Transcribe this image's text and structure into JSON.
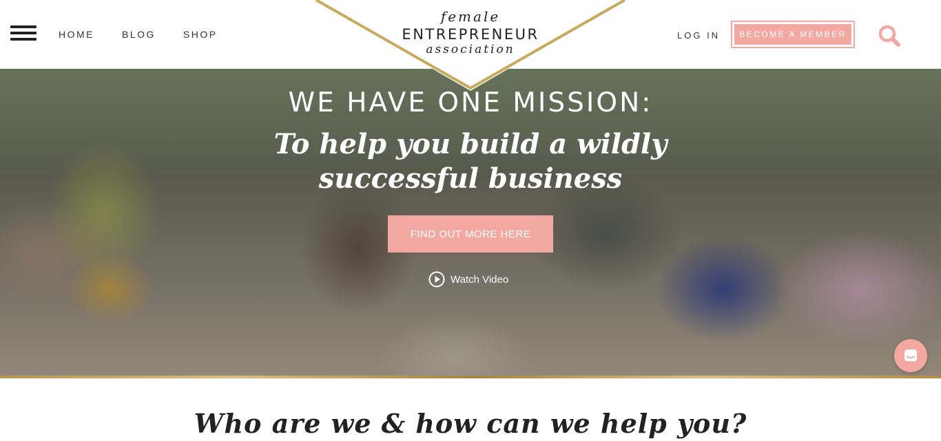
{
  "header": {
    "nav": [
      {
        "label": "HOME"
      },
      {
        "label": "BLOG"
      },
      {
        "label": "SHOP"
      }
    ],
    "logo": {
      "line1": "female",
      "line2": "ENTREPRENEUR",
      "line3": "association"
    },
    "login_label": "LOG IN",
    "member_label": "BECOME A MEMBER"
  },
  "hero": {
    "headline": "WE HAVE ONE MISSION:",
    "tagline": "To help you build a wildly successful business",
    "cta_label": "FIND OUT MORE HERE",
    "watch_label": "Watch Video"
  },
  "section": {
    "title": "Who are we & how can we help you?"
  },
  "colors": {
    "accent": "#f4a8a2",
    "gold": "#c9a95e",
    "text": "#222222"
  },
  "icons": [
    "menu-icon",
    "search-icon",
    "play-icon",
    "chat-icon"
  ]
}
